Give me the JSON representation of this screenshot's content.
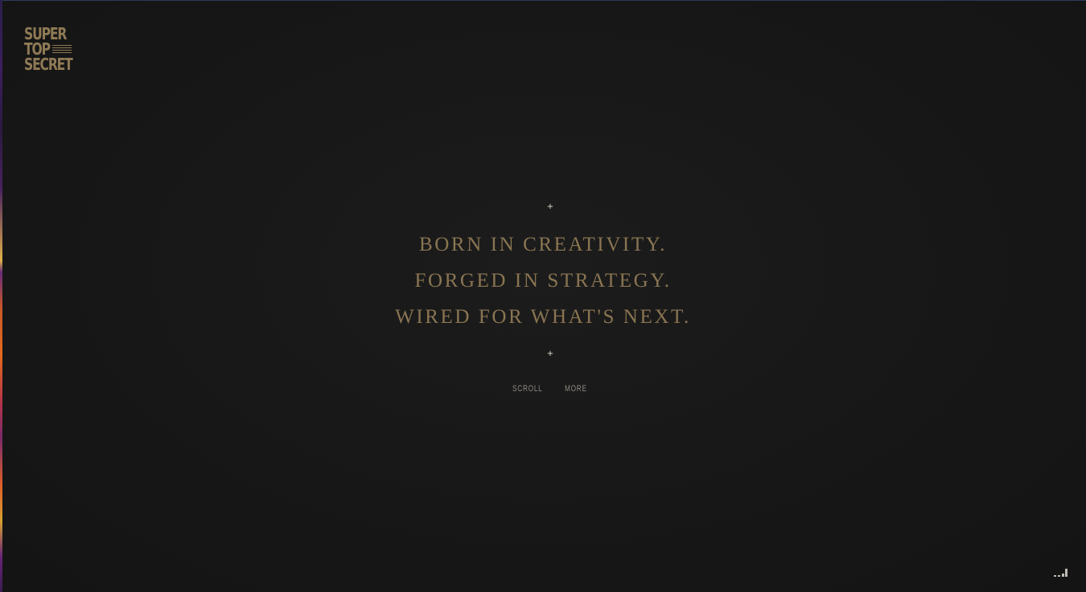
{
  "logo": {
    "line1": "SUPER",
    "line2": "TOP",
    "line3": "SECRET"
  },
  "hero": {
    "line1": "BORN IN CREATIVITY.",
    "line2": "FORGED IN STRATEGY.",
    "line3": "WIRED FOR WHAT'S NEXT."
  },
  "nav": {
    "scroll_label": "SCROLL",
    "more_label": "MORE"
  },
  "icons": {
    "menu": "hamburger-icon",
    "plus": "plus-icon",
    "audio": "audio-bars-icon"
  },
  "colors": {
    "background": "#161616",
    "gold": "#8a7552",
    "nav_text": "#8f8a82"
  }
}
